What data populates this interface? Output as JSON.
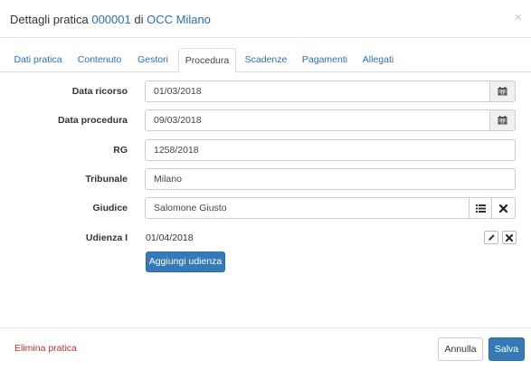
{
  "header": {
    "title_prefix": "Dettagli pratica",
    "practice_number": "000001",
    "title_mid": "di",
    "organization": "OCC Milano",
    "close_symbol": "×"
  },
  "tabs": [
    {
      "label": "Dati pratica",
      "active": false
    },
    {
      "label": "Contenuto",
      "active": false
    },
    {
      "label": "Gestori",
      "active": false
    },
    {
      "label": "Procedura",
      "active": true
    },
    {
      "label": "Scadenze",
      "active": false
    },
    {
      "label": "Pagamenti",
      "active": false
    },
    {
      "label": "Allegati",
      "active": false
    }
  ],
  "form": {
    "data_ricorso": {
      "label": "Data ricorso",
      "value": "01/03/2018"
    },
    "data_procedura": {
      "label": "Data procedura",
      "value": "09/03/2018"
    },
    "rg": {
      "label": "RG",
      "value": "1258/2018"
    },
    "tribunale": {
      "label": "Tribunale",
      "value": "Milano"
    },
    "giudice": {
      "label": "Giudice",
      "value": "Salomone Giusto"
    },
    "udienza": {
      "label": "Udienza I",
      "date": "01/04/2018"
    },
    "add_udienza_label": "Aggiungi udienza"
  },
  "footer": {
    "delete_label": "Elimina pratica",
    "cancel_label": "Annulla",
    "save_label": "Salva"
  },
  "colors": {
    "link": "#2a6fb4",
    "primary": "#337ab7",
    "danger": "#c9302c"
  },
  "icons": [
    "calendar-icon",
    "list-icon",
    "close-icon",
    "pencil-icon"
  ]
}
